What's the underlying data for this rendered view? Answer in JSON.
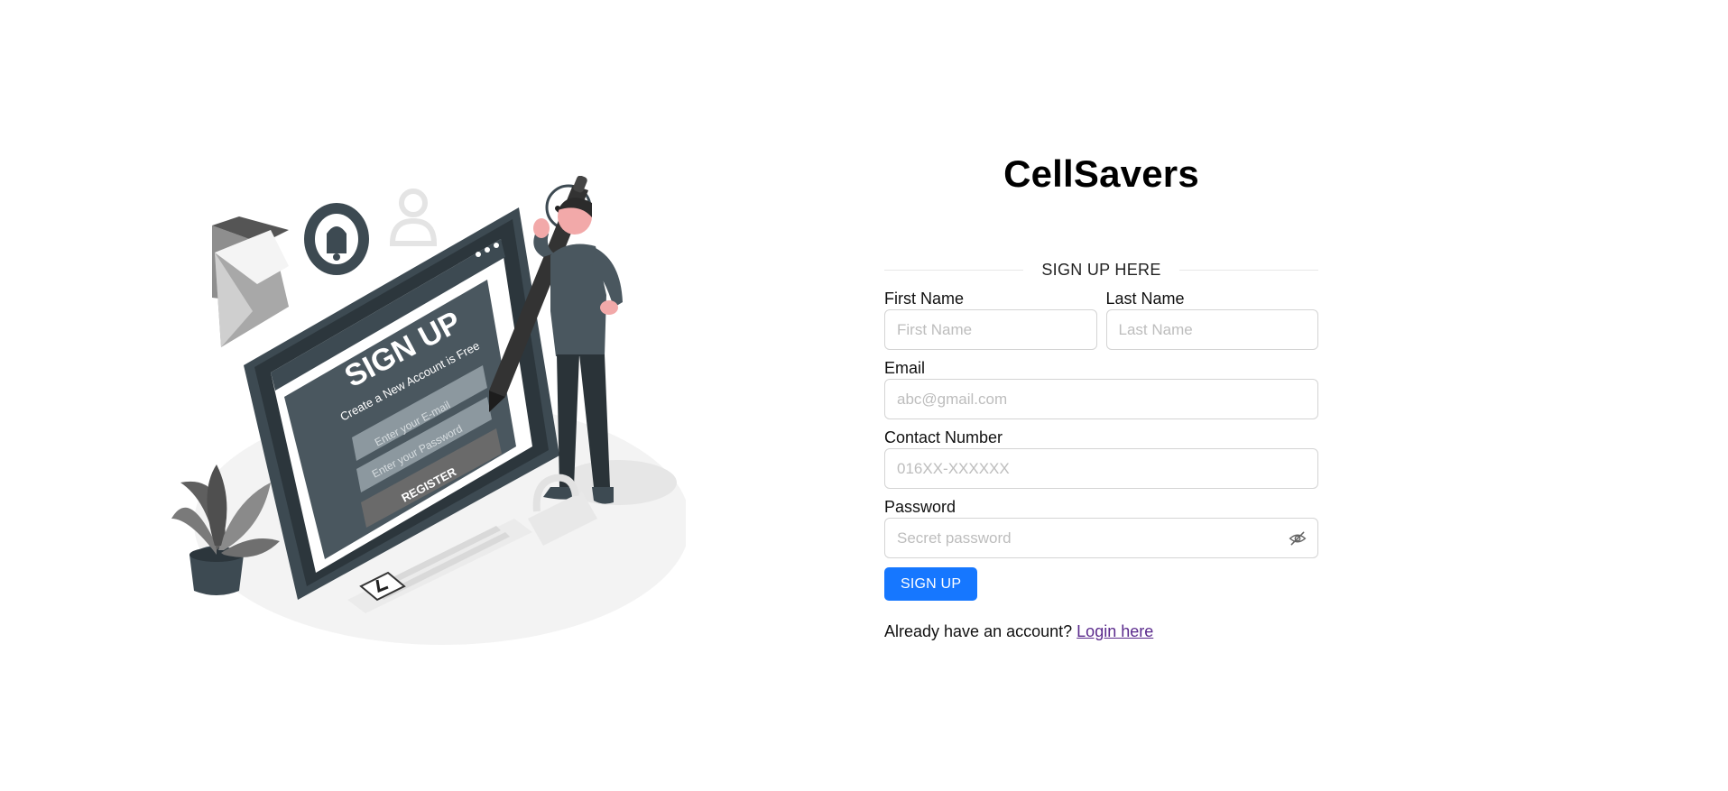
{
  "app": {
    "title": "CellSavers"
  },
  "illustration": {
    "sign_up_heading": "SIGN UP",
    "subtitle": "Create a New Account is Free",
    "email_field": "Enter your E-mail",
    "password_field": "Enter your Password",
    "register_button": "REGISTER"
  },
  "form": {
    "section_title": "SIGN UP HERE",
    "first_name": {
      "label": "First Name",
      "placeholder": "First Name",
      "value": ""
    },
    "last_name": {
      "label": "Last Name",
      "placeholder": "Last Name",
      "value": ""
    },
    "email": {
      "label": "Email",
      "placeholder": "abc@gmail.com",
      "value": ""
    },
    "contact": {
      "label": "Contact Number",
      "placeholder": "016XX-XXXXXX",
      "value": ""
    },
    "password": {
      "label": "Password",
      "placeholder": "Secret password",
      "value": "",
      "toggle_icon": "eye-slash-icon"
    },
    "submit_label": "SIGN UP",
    "login_prompt": "Already have an account?",
    "login_link": "Login here"
  },
  "colors": {
    "primary_button": "#1677ff",
    "link": "#5a2a8c",
    "illustration_dark": "#3d4a52"
  }
}
